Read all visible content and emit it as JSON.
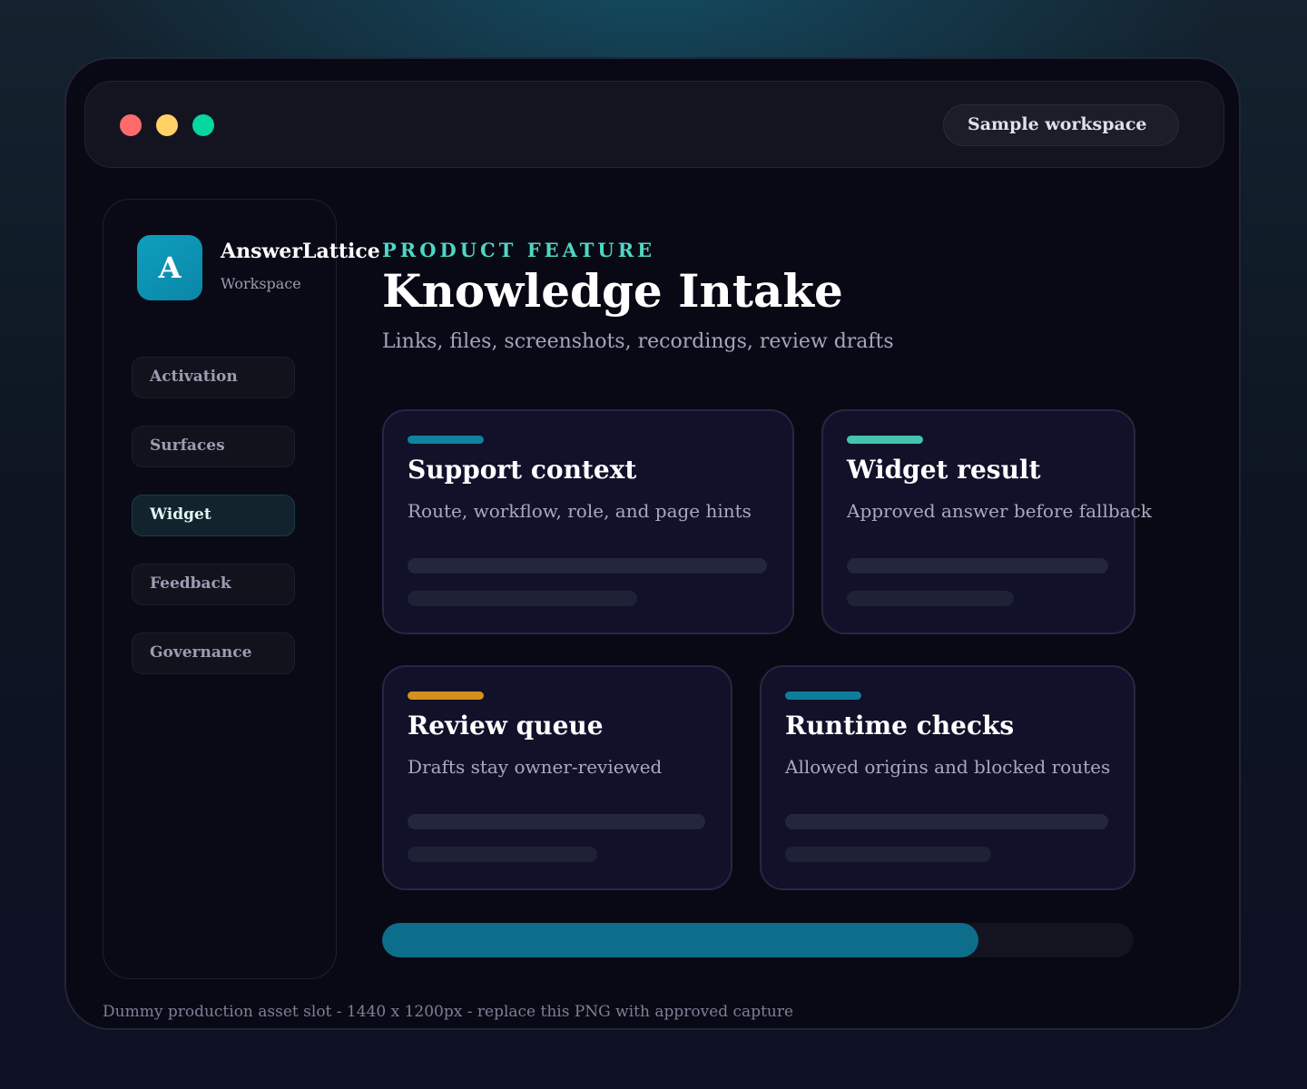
{
  "window": {
    "controls": [
      {
        "name": "close",
        "color": "#ff6b6b"
      },
      {
        "name": "minimize",
        "color": "#ffd166"
      },
      {
        "name": "maximize",
        "color": "#06d6a0"
      }
    ],
    "workspace_label": "Sample workspace"
  },
  "sidebar": {
    "logo_letter": "A",
    "brand_name": "AnswerLattice",
    "brand_sub": "Workspace",
    "items": [
      {
        "label": "Activation",
        "active": false
      },
      {
        "label": "Surfaces",
        "active": false
      },
      {
        "label": "Widget",
        "active": true
      },
      {
        "label": "Feedback",
        "active": false
      },
      {
        "label": "Governance",
        "active": false
      }
    ]
  },
  "main": {
    "eyebrow": "PRODUCT FEATURE",
    "title": "Knowledge Intake",
    "subtitle": "Links, files, screenshots, recordings, review drafts",
    "cards": [
      {
        "title": "Support context",
        "description": "Route, workflow, role, and page hints",
        "accent": "#10819e"
      },
      {
        "title": "Widget result",
        "description": "Approved answer before fallback",
        "accent": "#44c3ad"
      },
      {
        "title": "Review queue",
        "description": "Drafts stay owner-reviewed",
        "accent": "#d4901c"
      },
      {
        "title": "Runtime checks",
        "description": "Allowed origins and blocked routes",
        "accent": "#0f7e9d"
      }
    ],
    "progress_percent": 79.3
  },
  "footer_note": "Dummy production asset slot - 1440 x 1200px - replace this PNG with approved capture"
}
